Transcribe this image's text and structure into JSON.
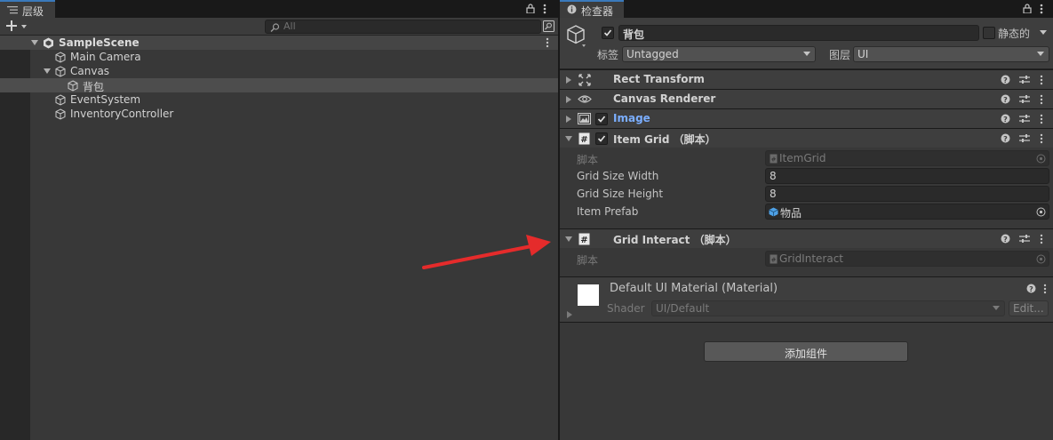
{
  "hierarchy": {
    "tab_label": "层级",
    "search_placeholder": "All",
    "items": [
      {
        "label": "SampleScene"
      },
      {
        "label": "Main Camera"
      },
      {
        "label": "Canvas"
      },
      {
        "label": "背包"
      },
      {
        "label": "EventSystem"
      },
      {
        "label": "InventoryController"
      }
    ]
  },
  "inspector": {
    "tab_label": "检查器",
    "object": {
      "name": "背包",
      "static_label": "静态的",
      "tag_label": "标签",
      "tag_value": "Untagged",
      "layer_label": "图层",
      "layer_value": "UI"
    },
    "components": [
      {
        "title": "Rect Transform"
      },
      {
        "title": "Canvas Renderer"
      },
      {
        "title": "Image"
      },
      {
        "title": "Item Grid （脚本）"
      },
      {
        "title": "Grid Interact （脚本）"
      }
    ],
    "item_grid": {
      "script_label": "脚本",
      "script_value": "ItemGrid",
      "width_label": "Grid Size Width",
      "width_value": "8",
      "height_label": "Grid Size Height",
      "height_value": "8",
      "prefab_label": "Item Prefab",
      "prefab_value": "物品"
    },
    "grid_interact": {
      "script_label": "脚本",
      "script_value": "GridInteract"
    },
    "material": {
      "title": "Default UI Material (Material)",
      "shader_label": "Shader",
      "shader_value": "UI/Default",
      "edit_label": "Edit..."
    },
    "add_component_label": "添加组件"
  },
  "colors": {
    "accent": "#3a79bb",
    "image_title": "#7baeff",
    "arrow": "#e52b2b"
  }
}
